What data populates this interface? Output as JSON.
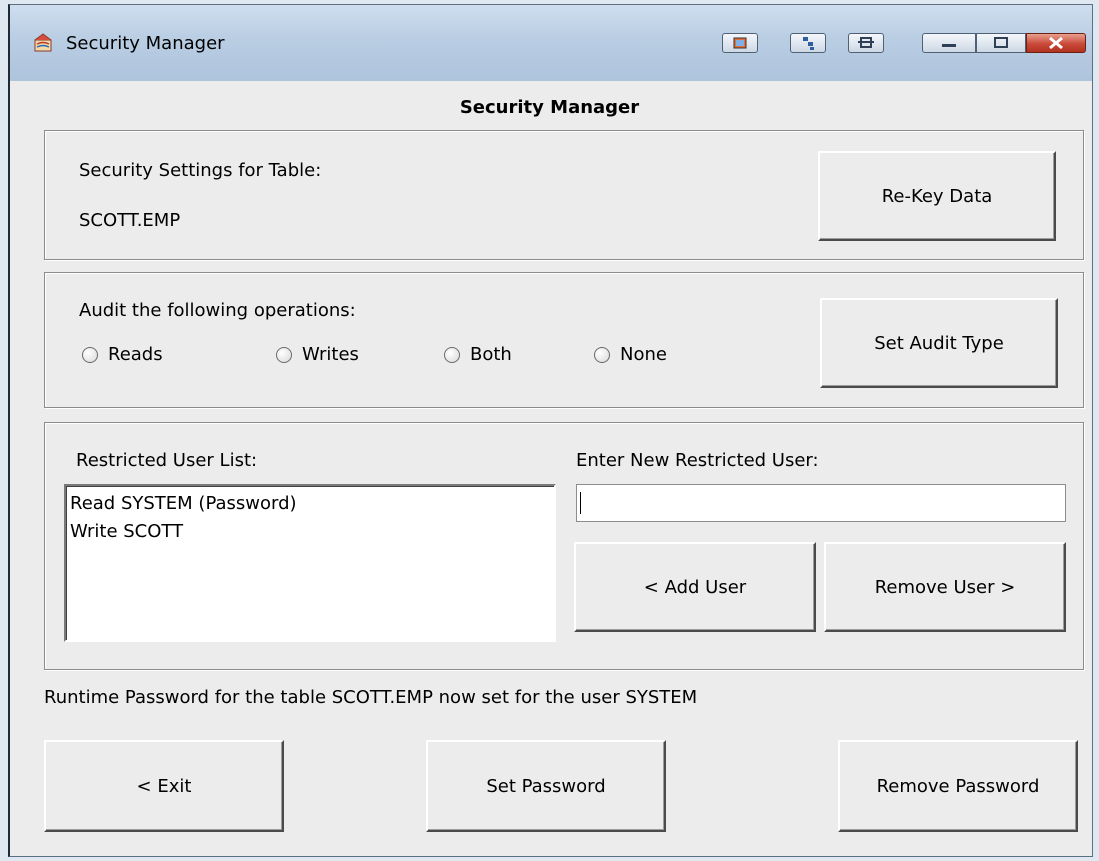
{
  "window": {
    "title": "Security Manager"
  },
  "heading": "Security Manager",
  "settings": {
    "label": "Security Settings for Table:",
    "table_name": "SCOTT.EMP",
    "rekey_button": "Re-Key Data"
  },
  "audit": {
    "label": "Audit the following operations:",
    "options": [
      "Reads",
      "Writes",
      "Both",
      "None"
    ],
    "set_button": "Set Audit Type"
  },
  "users": {
    "list_label": "Restricted User List:",
    "list_items": [
      "Read SYSTEM (Password)",
      "Write SCOTT"
    ],
    "new_user_label": "Enter New Restricted User:",
    "new_user_value": "",
    "add_button": "< Add User",
    "remove_button": "Remove User >"
  },
  "status_text": "Runtime Password for the table SCOTT.EMP now set for the user SYSTEM",
  "footer": {
    "exit_button": "< Exit",
    "set_password_button": "Set Password",
    "remove_password_button": "Remove Password"
  },
  "colors": {
    "titlebar": "#b9cde3",
    "client": "#ececec",
    "close_button": "#c94a3a"
  }
}
